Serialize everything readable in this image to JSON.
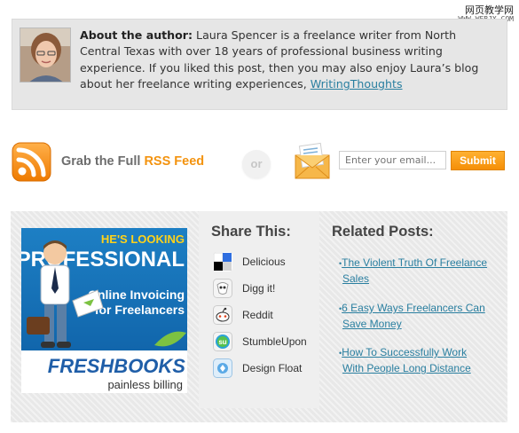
{
  "watermark": {
    "line1": "网页教学网",
    "line2": "WWW.WEBJX.COM"
  },
  "author": {
    "heading": "About the author:",
    "text": " Laura Spencer is a freelance writer from North Central Texas with over 18 years of professional business writing experience. If you liked this post, then you may also enjoy Laura’s blog about her freelance writing experiences, ",
    "link_label": "WritingThoughts"
  },
  "subscribe": {
    "rss_prefix": "Grab the Full ",
    "rss_accent": "RSS Feed",
    "or_label": "or",
    "email_placeholder": "Enter your email...",
    "submit_label": "Submit",
    "accent_color": "#f3930f"
  },
  "ad": {
    "headline_1": "HE'S LOOKING",
    "headline_2": "PROFESSIONAL",
    "tagline_1": "Online Invoicing",
    "tagline_2": "for Freelancers",
    "brand": "FRESHBOOKS",
    "slogan": "painless billing"
  },
  "share": {
    "title": "Share This:",
    "items": [
      {
        "label": "Delicious",
        "icon": "delicious-icon"
      },
      {
        "label": "Digg it!",
        "icon": "digg-icon"
      },
      {
        "label": "Reddit",
        "icon": "reddit-icon"
      },
      {
        "label": "StumbleUpon",
        "icon": "stumbleupon-icon"
      },
      {
        "label": "Design Float",
        "icon": "designfloat-icon"
      }
    ]
  },
  "related": {
    "title": "Related Posts:",
    "items": [
      {
        "line1": "The Violent Truth Of Freelance",
        "line2": "Sales"
      },
      {
        "line1": "6 Easy Ways Freelancers Can",
        "line2": "Save Money"
      },
      {
        "line1": "How To Successfully Work",
        "line2": "With People Long Distance"
      }
    ]
  }
}
